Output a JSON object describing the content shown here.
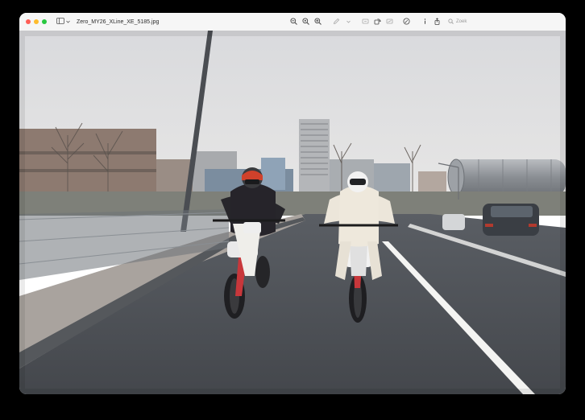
{
  "window": {
    "filename": "Zero_MY26_XLine_XE_5185.jpg"
  },
  "toolbar": {
    "search_placeholder": "Zoek",
    "icons": [
      "zoom-out-icon",
      "zoom-to-fit-icon",
      "zoom-in-icon",
      "markup-pen-icon",
      "chevron-down-icon",
      "crop-icon",
      "rotate-icon",
      "redact-icon",
      "annotate-icon",
      "info-icon",
      "share-icon",
      "search-icon"
    ]
  },
  "colors": {
    "close": "#ff5f57",
    "minimize": "#febc2e",
    "zoom": "#28c840"
  }
}
